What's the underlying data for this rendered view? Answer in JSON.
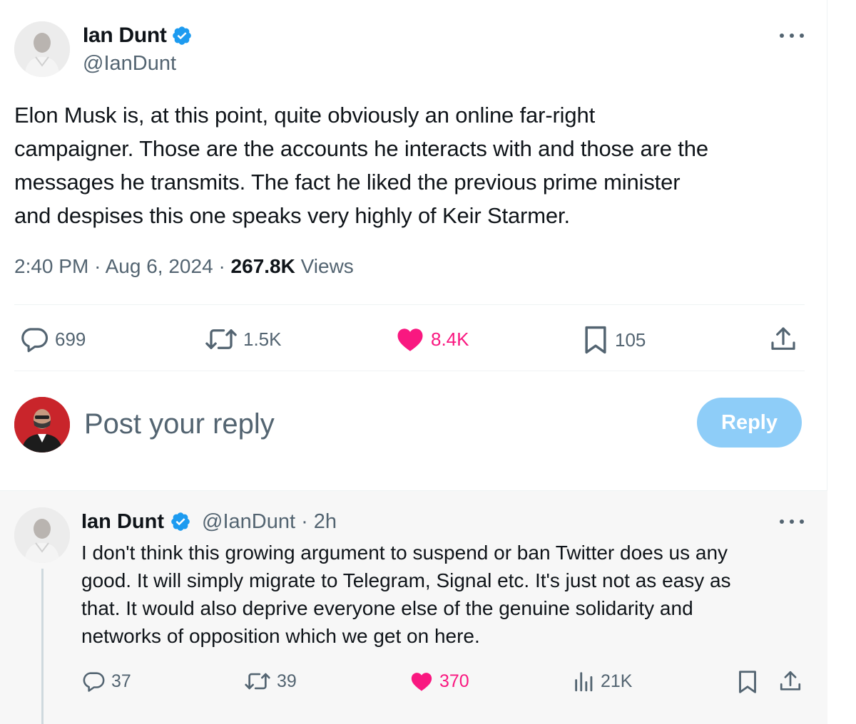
{
  "main_tweet": {
    "author_name": "Ian Dunt",
    "author_handle": "@IanDunt",
    "text_lines": [
      "Elon Musk is, at this point, quite obviously an online far-right",
      "campaigner. Those are the accounts he interacts with and those are the",
      "messages he transmits. The fact he liked the previous prime minister",
      "and despises this one speaks very highly of Keir Starmer."
    ],
    "time": "2:40 PM",
    "date": "Aug 6, 2024",
    "separator": "·",
    "views_count": "267.8K",
    "views_label": "Views",
    "replies": "699",
    "reposts": "1.5K",
    "likes": "8.4K",
    "bookmarks": "105"
  },
  "composer": {
    "placeholder": "Post your reply",
    "reply_button": "Reply"
  },
  "reply_tweet": {
    "author_name": "Ian Dunt",
    "handle_time": "@IanDunt · 2h",
    "text_lines": [
      "I don't think this growing argument to suspend or ban Twitter does us any",
      "good. It will simply migrate to Telegram, Signal etc. It's just not as easy as",
      "that. It would also deprive everyone else of the genuine solidarity and",
      "networks of opposition which we get on here."
    ],
    "replies": "37",
    "reposts": "39",
    "likes": "370",
    "views": "21K"
  },
  "colors": {
    "text_primary": "#0f1419",
    "text_secondary": "#536471",
    "verified_blue": "#1d9bf0",
    "like_pink": "#f91880",
    "reply_button_disabled": "#8ecdf8"
  },
  "icons": [
    "verified-badge-icon",
    "more-icon",
    "reply-icon",
    "repost-icon",
    "like-icon",
    "bookmark-icon",
    "share-icon",
    "views-icon"
  ]
}
